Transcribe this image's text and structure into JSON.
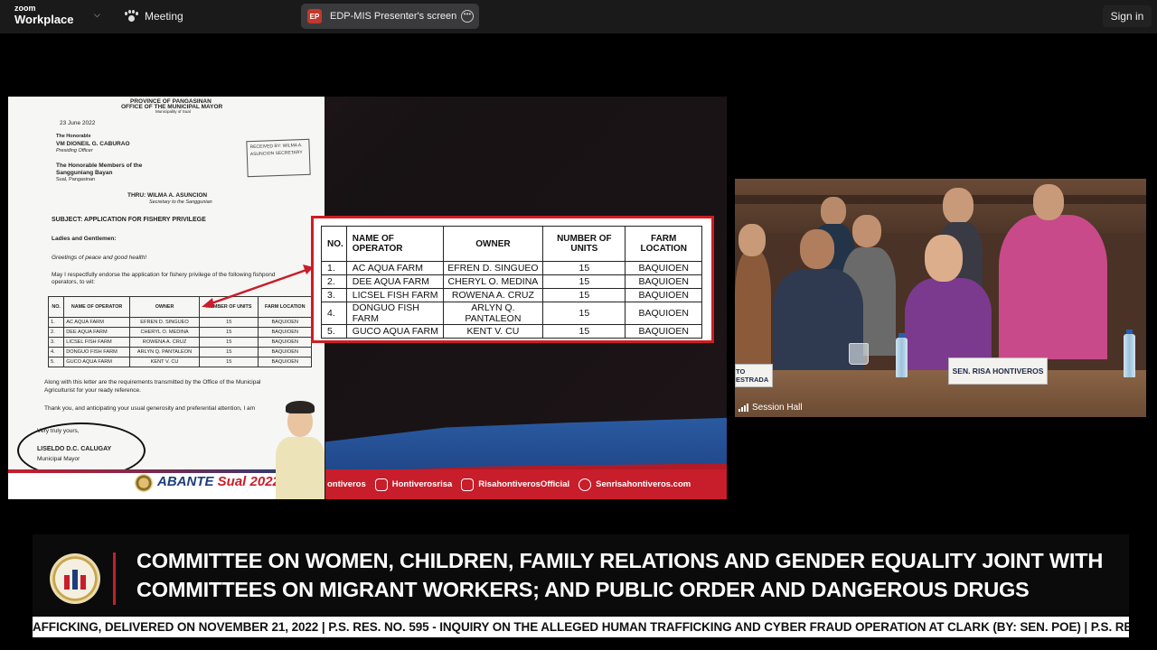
{
  "app": {
    "brand_line1": "zoom",
    "brand_line2": "Workplace",
    "meeting_label": "Meeting",
    "presenter_initials": "EP",
    "presenter_label": "EDP-MIS Presenter's screen",
    "signin_label": "Sign in"
  },
  "letter": {
    "province": "PROVINCE OF PANGASINAN",
    "office": "OFFICE OF THE MUNICIPAL MAYOR",
    "municipality": "Municipality of Sual",
    "date": "23 June 2022",
    "honorable": "The Honorable",
    "vm_name": "VM DIONEIL G. CABURAO",
    "vm_title": "Presiding Officer",
    "members_line1": "The Honorable Members of the",
    "members_line2": "Sangguniang Bayan",
    "members_line3": "Sual, Pangasinan",
    "thru": "THRU: WILMA A. ASUNCION",
    "thru_title": "Secretary to the Sanggunian",
    "received_stamp": "RECEIVED BY: WILMA A. ASUNCION SECRETARY",
    "subject": "SUBJECT: APPLICATION FOR FISHERY PRIVILEGE",
    "salutation": "Ladies and Gentlemen:",
    "greetings": "Greetings of peace and good health!",
    "endorse_line1": "May I respectfully endorse the application for fishery privilege of the following fishpond",
    "endorse_line2": "operators, to wit:",
    "along_line1": "Along with this letter are the requirements transmitted by the Office of the Municipal",
    "along_line2": "Agriculturist for your ready reference.",
    "thanks": "Thank you, and anticipating your usual generosity and preferential attention, I am",
    "closing": "Very truly yours,",
    "signatory": "LISELDO D.C. CALUGAY",
    "signatory_title": "Municipal Mayor",
    "banner_text": "ABANTE",
    "banner_script": "Sual 2022"
  },
  "operators_table": {
    "headers": [
      "NO.",
      "NAME OF OPERATOR",
      "OWNER",
      "NUMBER OF UNITS",
      "FARM LOCATION"
    ],
    "rows": [
      [
        "1.",
        "AC AQUA FARM",
        "EFREN D. SINGUEO",
        "15",
        "BAQUIOEN"
      ],
      [
        "2.",
        "DEE AQUA FARM",
        "CHERYL O. MEDINA",
        "15",
        "BAQUIOEN"
      ],
      [
        "3.",
        "LICSEL FISH FARM",
        "ROWENA A. CRUZ",
        "15",
        "BAQUIOEN"
      ],
      [
        "4.",
        "DONGUO FISH FARM",
        "ARLYN Q. PANTALEON",
        "15",
        "BAQUIOEN"
      ],
      [
        "5.",
        "GUCO AQUA FARM",
        "KENT V. CU",
        "15",
        "BAQUIOEN"
      ]
    ]
  },
  "social": {
    "facebook": "ontiveros",
    "instagram": "Hontiverosrisa",
    "youtube": "RisahontiverosOfficial",
    "website": "Senrisahontiveros.com"
  },
  "video": {
    "nameplate_main": "SEN. RISA HONTIVEROS",
    "nameplate_left": "TO ESTRADA",
    "label": "Session Hall"
  },
  "lower_third": {
    "line1": "COMMITTEE ON WOMEN, CHILDREN, FAMILY RELATIONS AND GENDER EQUALITY JOINT WITH",
    "line2": "COMMITTEES ON MIGRANT WORKERS; AND PUBLIC ORDER AND DANGEROUS DRUGS",
    "ticker": "AFFICKING, DELIVERED ON NOVEMBER 21, 2022  |  P.S. RES. NO. 595 - INQUIRY ON THE ALLEGED HUMAN TRAFFICKING AND CYBER FRAUD OPERATION AT CLARK (BY: SEN. POE)  |  P.S. RES."
  },
  "colors": {
    "accent_red": "#d01c22",
    "brand_blue": "#1c3d7c",
    "topbar": "#1a1a1a"
  },
  "icons": [
    "chevron-down-icon",
    "paw-icon",
    "more-options-icon",
    "signal-bars-icon",
    "instagram-icon",
    "youtube-icon",
    "web-icon",
    "senate-seal-icon"
  ]
}
